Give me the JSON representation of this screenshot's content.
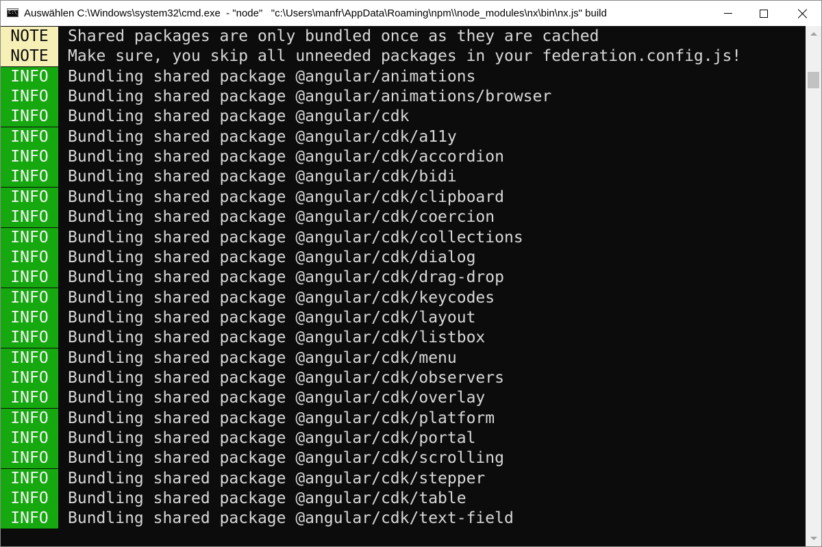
{
  "window": {
    "icon_text": "C:\\_",
    "title": "Auswählen C:\\Windows\\system32\\cmd.exe  - \"node\"   \"c:\\Users\\manfr\\AppData\\Roaming\\npm\\\\node_modules\\nx\\bin\\nx.js\" build",
    "icon": "cmd-icon",
    "controls": [
      "minimize-icon",
      "maximize-icon",
      "close-icon"
    ]
  },
  "colors": {
    "note_bg": "#f7f0b6",
    "info_bg": "#16a80f",
    "console_bg": "#0c0c0c",
    "text": "#d8d8d8"
  },
  "console": {
    "lines": [
      {
        "tag": "NOTE",
        "text": "Shared packages are only bundled once as they are cached"
      },
      {
        "tag": "NOTE",
        "text": "Make sure, you skip all unneeded packages in your federation.config.js!"
      },
      {
        "tag": "INFO",
        "text": "Bundling shared package @angular/animations"
      },
      {
        "tag": "INFO",
        "text": "Bundling shared package @angular/animations/browser"
      },
      {
        "tag": "INFO",
        "text": "Bundling shared package @angular/cdk"
      },
      {
        "tag": "INFO",
        "text": "Bundling shared package @angular/cdk/a11y"
      },
      {
        "tag": "INFO",
        "text": "Bundling shared package @angular/cdk/accordion"
      },
      {
        "tag": "INFO",
        "text": "Bundling shared package @angular/cdk/bidi"
      },
      {
        "tag": "INFO",
        "text": "Bundling shared package @angular/cdk/clipboard"
      },
      {
        "tag": "INFO",
        "text": "Bundling shared package @angular/cdk/coercion"
      },
      {
        "tag": "INFO",
        "text": "Bundling shared package @angular/cdk/collections"
      },
      {
        "tag": "INFO",
        "text": "Bundling shared package @angular/cdk/dialog"
      },
      {
        "tag": "INFO",
        "text": "Bundling shared package @angular/cdk/drag-drop"
      },
      {
        "tag": "INFO",
        "text": "Bundling shared package @angular/cdk/keycodes"
      },
      {
        "tag": "INFO",
        "text": "Bundling shared package @angular/cdk/layout"
      },
      {
        "tag": "INFO",
        "text": "Bundling shared package @angular/cdk/listbox"
      },
      {
        "tag": "INFO",
        "text": "Bundling shared package @angular/cdk/menu"
      },
      {
        "tag": "INFO",
        "text": "Bundling shared package @angular/cdk/observers"
      },
      {
        "tag": "INFO",
        "text": "Bundling shared package @angular/cdk/overlay"
      },
      {
        "tag": "INFO",
        "text": "Bundling shared package @angular/cdk/platform"
      },
      {
        "tag": "INFO",
        "text": "Bundling shared package @angular/cdk/portal"
      },
      {
        "tag": "INFO",
        "text": "Bundling shared package @angular/cdk/scrolling"
      },
      {
        "tag": "INFO",
        "text": "Bundling shared package @angular/cdk/stepper"
      },
      {
        "tag": "INFO",
        "text": "Bundling shared package @angular/cdk/table"
      },
      {
        "tag": "INFO",
        "text": "Bundling shared package @angular/cdk/text-field"
      }
    ]
  }
}
